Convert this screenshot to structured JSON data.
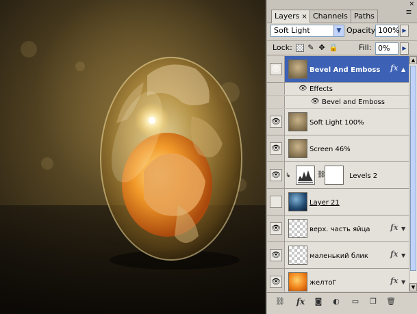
{
  "tabs": [
    {
      "label": "Layers",
      "close": "×"
    },
    {
      "label": "Channels"
    },
    {
      "label": "Paths"
    }
  ],
  "close_label": "×",
  "menu_glyph": "≡",
  "blend_mode": "Soft Light",
  "opacity_label": "Opacity:",
  "opacity_value": "100%",
  "lock_label": "Lock:",
  "fill_label": "Fill:",
  "fill_value": "0%",
  "fx_glyph": "fx",
  "layers": [
    {
      "name": "Bevel And Emboss",
      "selected": true,
      "fx": true
    },
    {
      "name": "Effects",
      "sub": true
    },
    {
      "name": "Bevel and Emboss",
      "sub": true
    },
    {
      "name": "Soft Light 100%"
    },
    {
      "name": "Screen 46%"
    },
    {
      "name": "Levels 2"
    },
    {
      "name": "Layer 21",
      "hidden": true
    },
    {
      "name": "верх. часть яйца",
      "fx": true
    },
    {
      "name": "маленький блик",
      "fx": true
    },
    {
      "name": "желтоГ",
      "fx": true
    }
  ],
  "colors": {
    "selection": "#3d62b5",
    "panel": "#d4d0c8"
  },
  "icons": [
    "eye-icon",
    "chain-link-icon",
    "fx-icon",
    "layer-mask-icon",
    "adjustment-icon",
    "folder-icon",
    "new-layer-icon",
    "trash-icon"
  ]
}
